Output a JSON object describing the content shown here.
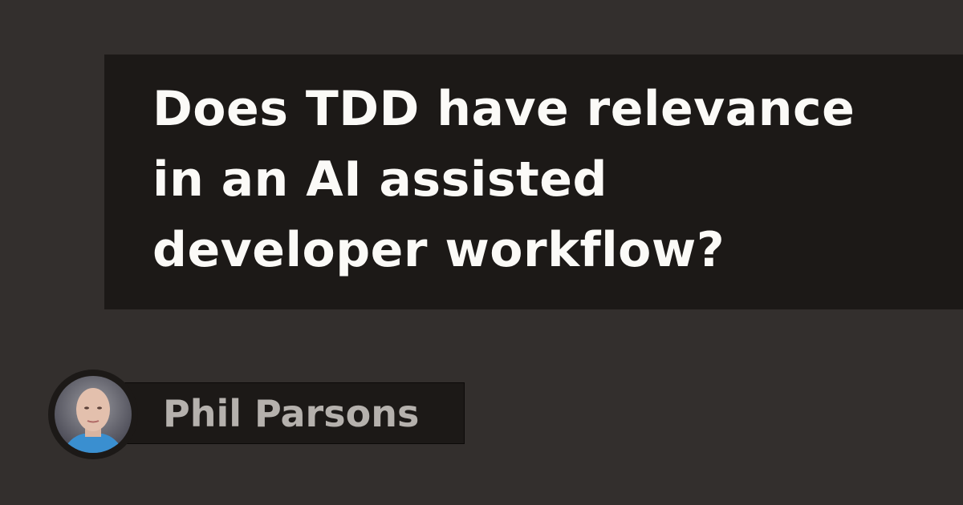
{
  "title": {
    "lines": [
      "Does TDD have relevance",
      "in an AI assisted",
      "developer workflow?"
    ]
  },
  "author": {
    "name": "Phil Parsons"
  },
  "colors": {
    "background": "#332f2d",
    "panel": "#1c1917",
    "title_text": "#fbfaf7",
    "name_text": "#b5b1ad"
  }
}
